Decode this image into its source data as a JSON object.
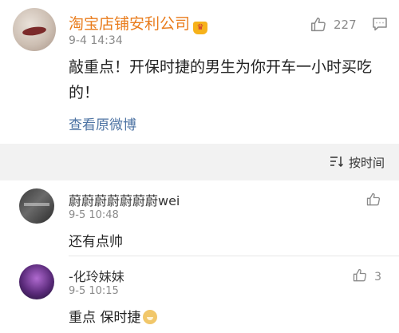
{
  "post": {
    "author": "淘宝店铺安利公司",
    "time": "9-4 14:34",
    "like_count": "227",
    "text": "敲重点！开保时捷的男生为你开车一小时买吃的！",
    "view_original": "查看原微博"
  },
  "sort": {
    "label": "按时间",
    "icon": "sort-icon"
  },
  "comments": [
    {
      "name": "蔚蔚蔚蔚蔚蔚蔚wei",
      "time": "9-5 10:48",
      "text": "还有点帅",
      "like_count": ""
    },
    {
      "name": "-化玲妹妹",
      "time": "9-5 10:15",
      "text": "重点 保时捷",
      "like_count": "3"
    }
  ],
  "colors": {
    "author": "#e97c1c",
    "link": "#4d73a3",
    "muted": "#8a8a8a",
    "band": "#f2f2f2"
  }
}
